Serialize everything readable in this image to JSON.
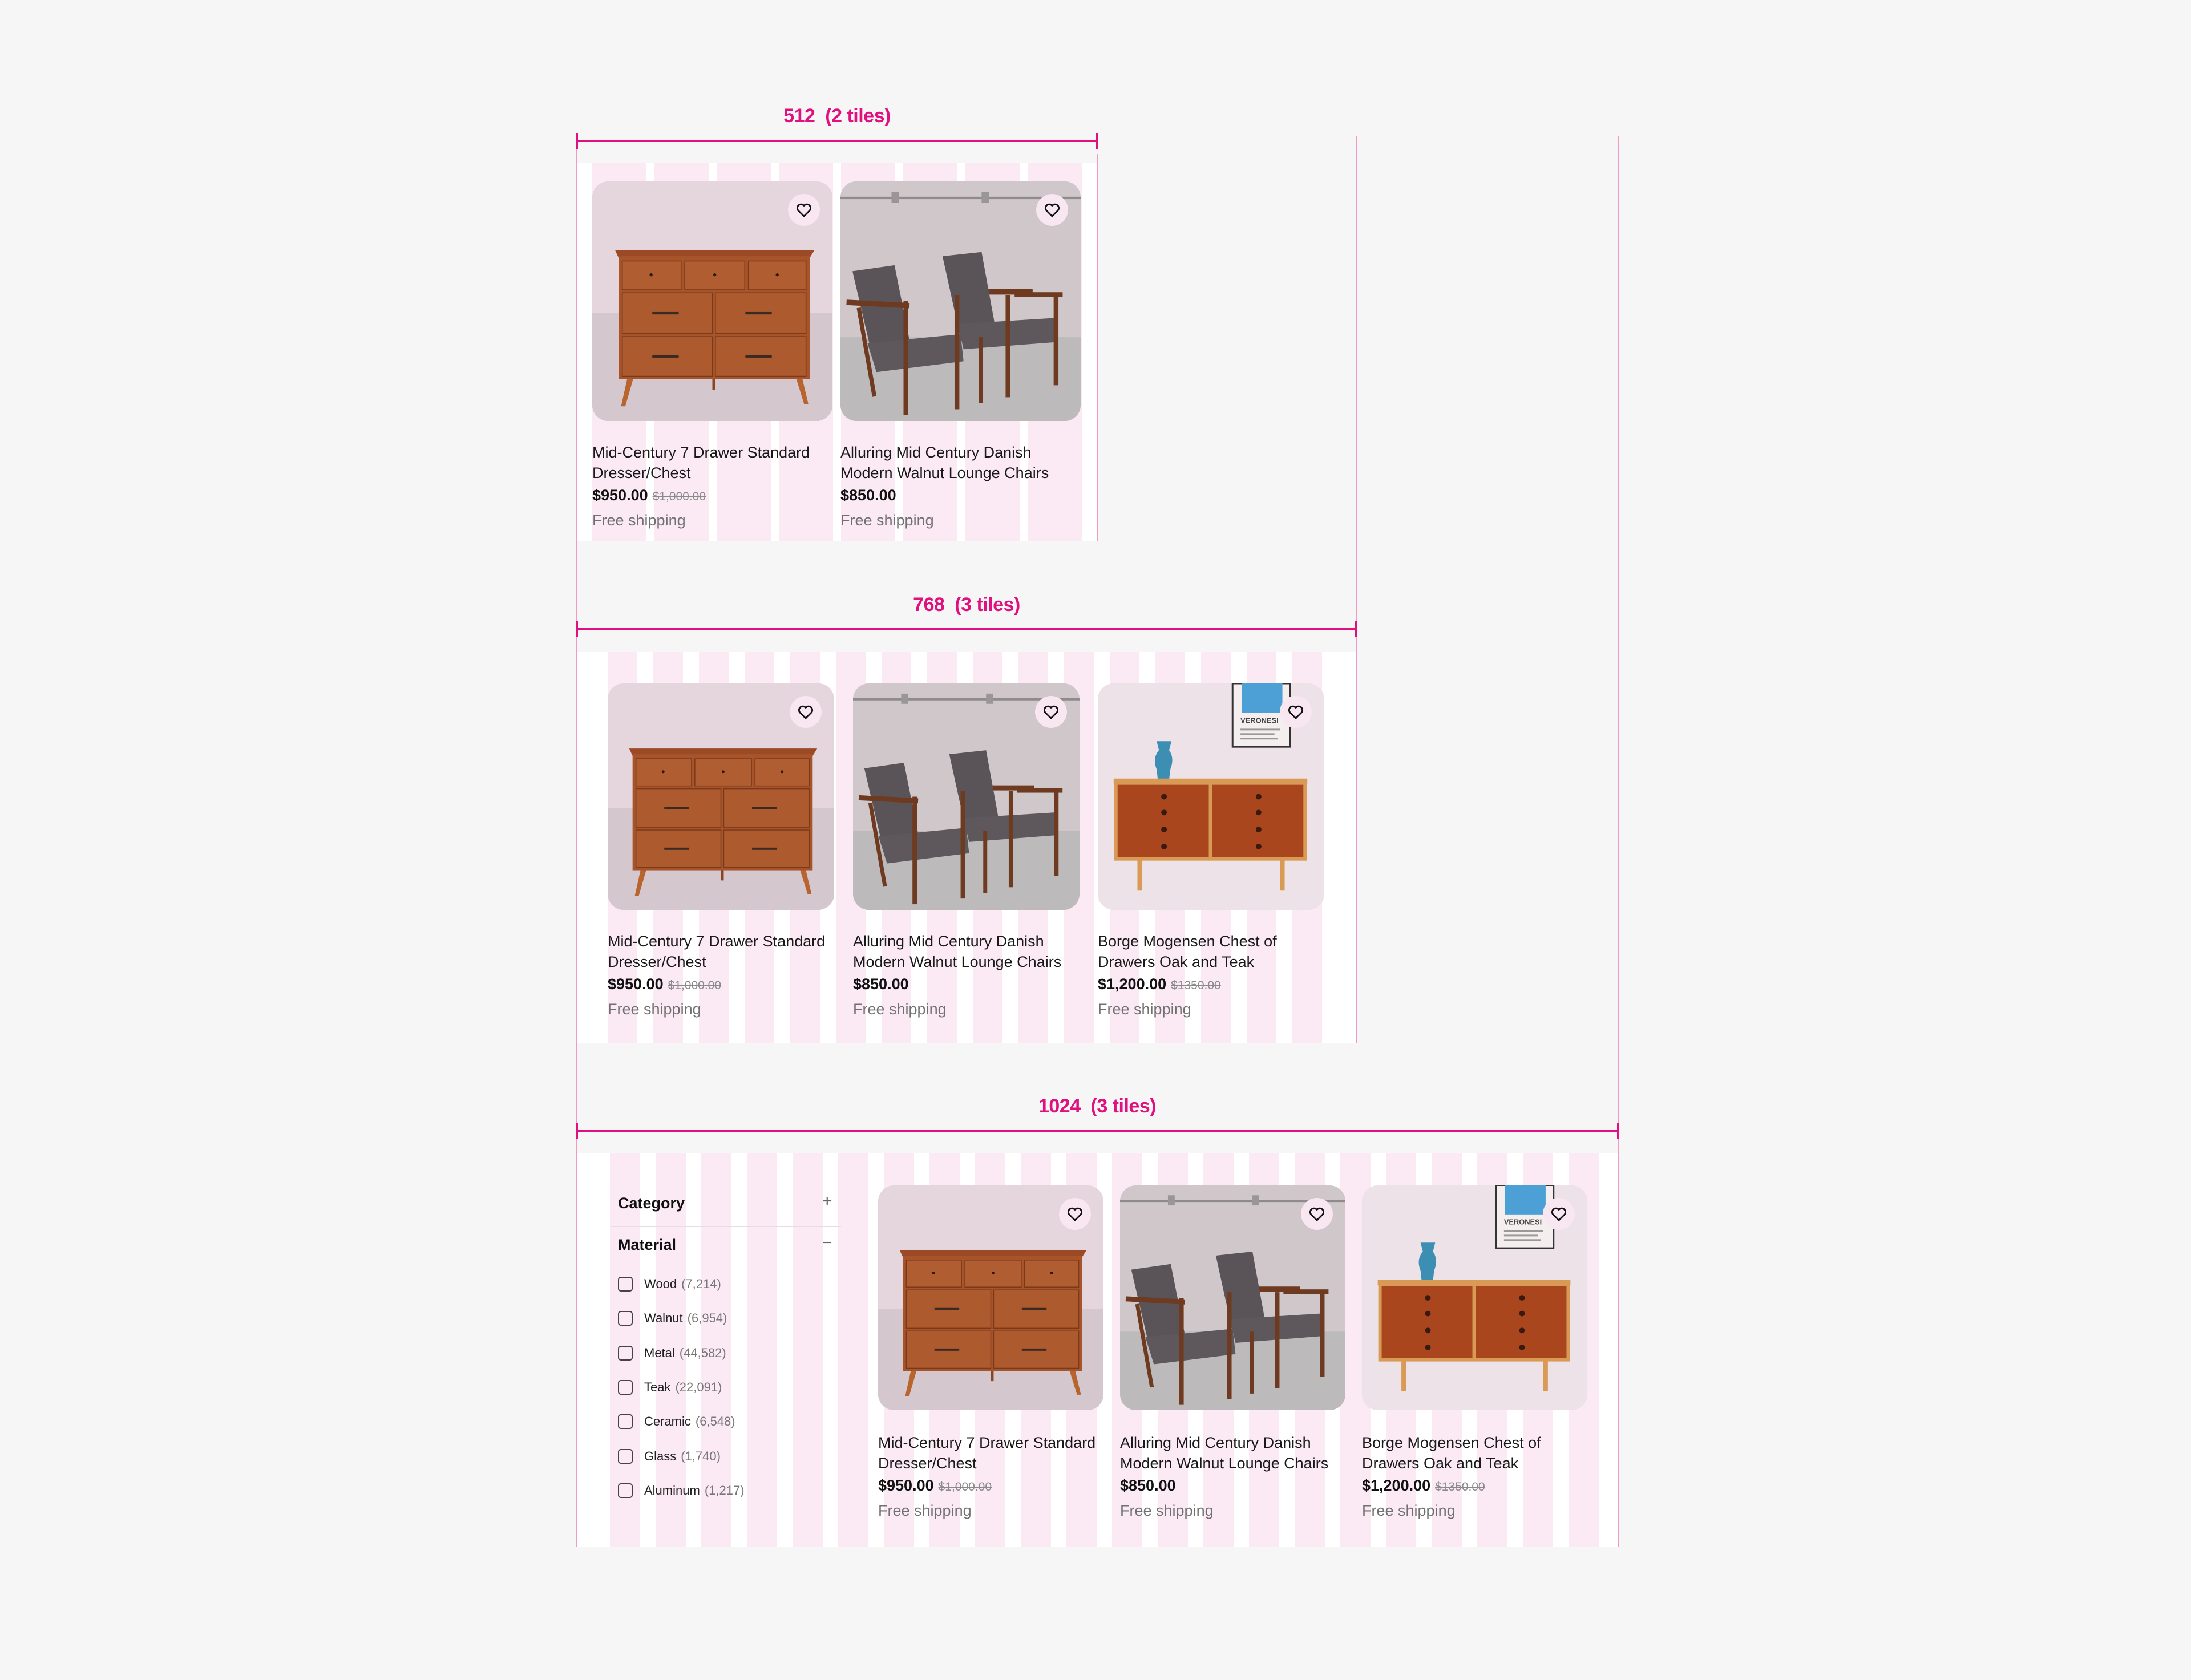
{
  "breakpoints": [
    {
      "label": "512  (2 tiles)",
      "tiles": [
        0,
        1
      ]
    },
    {
      "label": "768  (3 tiles)",
      "tiles": [
        0,
        1,
        2
      ]
    },
    {
      "label": "1024  (3 tiles)",
      "tiles": [
        0,
        1,
        2
      ]
    }
  ],
  "products": [
    {
      "title": "Mid-Century 7 Drawer Standard Dresser/Chest",
      "price": "$950.00",
      "original_price": "$1,000.00",
      "shipping": "Free shipping",
      "image": "walnut-dresser",
      "favorite_icon": "heart-outline-icon"
    },
    {
      "title": "Alluring Mid Century Danish Modern Walnut Lounge Chairs",
      "price": "$850.00",
      "original_price": "",
      "shipping": "Free shipping",
      "image": "lounge-chairs",
      "favorite_icon": "heart-outline-icon"
    },
    {
      "title": "Borge Mogensen Chest of Drawers Oak and Teak",
      "price": "$1,200.00",
      "original_price": "$1350.00",
      "shipping": "Free shipping",
      "image": "teak-chest",
      "poster_text": "VERONESI",
      "favorite_icon": "heart-outline-icon"
    }
  ],
  "sidebar": {
    "sections": [
      {
        "title": "Category",
        "toggle": "+",
        "expanded": false
      },
      {
        "title": "Material",
        "toggle": "−",
        "expanded": true
      }
    ],
    "material_options": [
      {
        "label": "Wood",
        "count": "(7,214)",
        "checked": false
      },
      {
        "label": "Walnut",
        "count": "(6,954)",
        "checked": false
      },
      {
        "label": "Metal",
        "count": "(44,582)",
        "checked": false
      },
      {
        "label": "Teak",
        "count": "(22,091)",
        "checked": false
      },
      {
        "label": "Ceramic",
        "count": "(6,548)",
        "checked": false
      },
      {
        "label": "Glass",
        "count": "(1,740)",
        "checked": false
      },
      {
        "label": "Aluminum",
        "count": "(1,217)",
        "checked": false
      }
    ]
  },
  "colors": {
    "annotation": "#e0117f",
    "guide": "#f29ac6",
    "column": "#fbeaf3",
    "page_bg": "#f6f6f6"
  }
}
